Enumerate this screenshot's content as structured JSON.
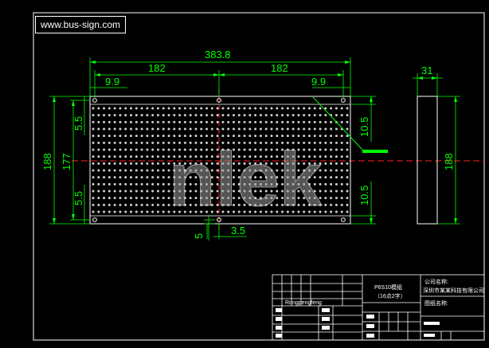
{
  "header": {
    "website": "www.bus-sign.com"
  },
  "dimensions": {
    "overall_width": "383.8",
    "half_width_left": "182",
    "half_width_right": "182",
    "edge_left": "9.9",
    "edge_right": "9.9",
    "height": "188",
    "inner_height": "177",
    "margin_top": "5.5",
    "margin_bottom": "5.5",
    "hole_top": "10.5",
    "hole_bottom": "10.5",
    "bottom_small": "5",
    "bottom_offset": "3.5",
    "side_width": "31",
    "side_height": "188"
  },
  "watermark": {
    "text": "nlek"
  },
  "title_block": {
    "product_line1": "P6S10模组",
    "product_line2": "（16点2字）",
    "company_line1": "公司名称:",
    "company_line2": "深圳市某某科技有限公司",
    "drawing_label": "图纸名称:",
    "row_label": "Rongpengfeng"
  },
  "colors": {
    "background": "#000000",
    "dimension": "#00ff00",
    "frame": "#ffffff",
    "panel_dots": "#cfcfcf",
    "center_line": "#ff2020",
    "watermark": "#9a9a9a"
  }
}
